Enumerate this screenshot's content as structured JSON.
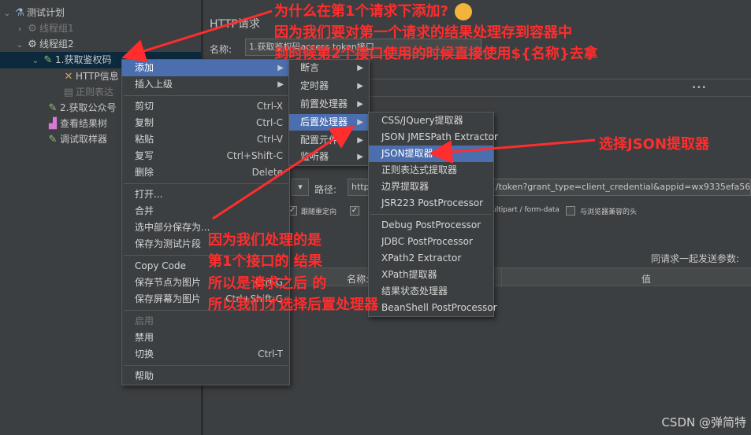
{
  "tree": {
    "items": [
      {
        "label": "测试计划"
      },
      {
        "label": "线程组1"
      },
      {
        "label": "线程组2"
      },
      {
        "label": "1.获取鉴权码"
      },
      {
        "label": "HTTP信息"
      },
      {
        "label": "正则表达"
      },
      {
        "label": "2.获取公众号"
      },
      {
        "label": "查看结果树"
      },
      {
        "label": "调试取样器"
      }
    ]
  },
  "panel": {
    "title": "HTTP请求",
    "name_label": "名称:",
    "name_value": "1.获取鉴权码access token接口",
    "path_label": "路径:",
    "path_value_prefix": "http",
    "path_value_suffix": "/token?grant_type=client_credential&appid=wx9335efa56e8cb",
    "follow_redirect": "跟随重定向",
    "multipart": "ultipart / form-data",
    "browser_compatible": "与浏览器兼容的头",
    "send_params": "同请求一起发送参数:",
    "col_name": "名称:",
    "col_value": "值",
    "dots": "•••"
  },
  "menu1": {
    "items": [
      {
        "label": "添加",
        "acc": ""
      },
      {
        "label": "插入上级",
        "acc": ""
      },
      {
        "label": "剪切",
        "acc": "Ctrl-X"
      },
      {
        "label": "复制",
        "acc": "Ctrl-C"
      },
      {
        "label": "粘贴",
        "acc": "Ctrl-V"
      },
      {
        "label": "复写",
        "acc": "Ctrl+Shift-C"
      },
      {
        "label": "删除",
        "acc": "Delete"
      },
      {
        "label": "打开...",
        "acc": ""
      },
      {
        "label": "合并",
        "acc": ""
      },
      {
        "label": "选中部分保存为...",
        "acc": ""
      },
      {
        "label": "保存为测试片段",
        "acc": ""
      },
      {
        "label": "Copy Code",
        "acc": ""
      },
      {
        "label": "保存节点为图片",
        "acc": "Ctrl-G"
      },
      {
        "label": "保存屏幕为图片",
        "acc": "Ctrl+Shift-G"
      },
      {
        "label": "启用",
        "acc": ""
      },
      {
        "label": "禁用",
        "acc": ""
      },
      {
        "label": "切换",
        "acc": "Ctrl-T"
      },
      {
        "label": "帮助",
        "acc": ""
      }
    ]
  },
  "menu2": {
    "items": [
      {
        "label": "断言"
      },
      {
        "label": "定时器"
      },
      {
        "label": "前置处理器"
      },
      {
        "label": "后置处理器"
      },
      {
        "label": "配置元件"
      },
      {
        "label": "监听器"
      }
    ]
  },
  "menu3": {
    "items": [
      {
        "label": "CSS/JQuery提取器"
      },
      {
        "label": "JSON JMESPath Extractor"
      },
      {
        "label": "JSON提取器"
      },
      {
        "label": "正则表达式提取器"
      },
      {
        "label": "边界提取器"
      },
      {
        "label": "JSR223 PostProcessor"
      },
      {
        "label": "Debug PostProcessor"
      },
      {
        "label": "JDBC PostProcessor"
      },
      {
        "label": "XPath2 Extractor"
      },
      {
        "label": "XPath提取器"
      },
      {
        "label": "结果状态处理器"
      },
      {
        "label": "BeanShell PostProcessor"
      }
    ]
  },
  "annotations": {
    "q1": "为什么在第1个请求下添加?",
    "q2": "因为我们要对第一个请求的结果处理存到容器中",
    "q3": "到时候第2个接口使用的时候直接使用${名称}去拿",
    "select_json": "选择JSON提取器",
    "r1": "因为我们处理的是",
    "r2": "第1个接口的 结果",
    "r3": "所以是请求之后 的",
    "r4": "所以我们才选择后置处理器"
  },
  "watermark": "CSDN @弹简特",
  "colors": {
    "annotation": "#ff2d2d",
    "highlight": "#4b6eaf",
    "background": "#3c3f41"
  }
}
